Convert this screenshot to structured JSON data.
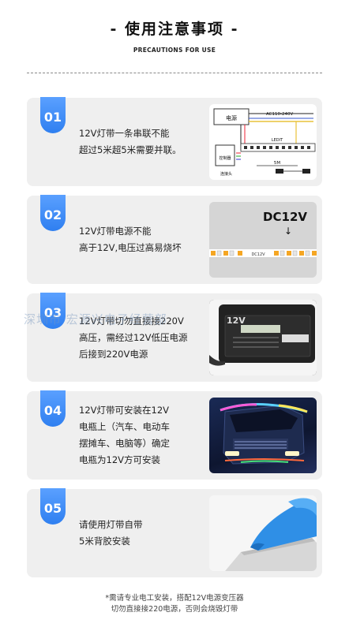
{
  "header": {
    "title": "- 使用注意事项 -",
    "subtitle": "PRECAUTIONS FOR USE"
  },
  "cards": [
    {
      "number": "01",
      "lines": [
        "12V灯带一条串联不能",
        "超过5米超5米需要并联。"
      ],
      "diagram": {
        "power": "电源",
        "voltage": "AC110-240V",
        "controller": "控制器",
        "strip": "LEDIT",
        "length": "5M",
        "plug": "连接头"
      }
    },
    {
      "number": "02",
      "lines": [
        "12V灯带电源不能",
        "高于12V,电压过高易烧坏"
      ],
      "image": {
        "label": "DC12V",
        "strip_label": "DC12V"
      }
    },
    {
      "number": "03",
      "lines": [
        "12V灯带切勿直接接220V",
        "高压，需经过12V低压电源",
        "后接到220V电源"
      ],
      "image": {
        "label": "12V"
      }
    },
    {
      "number": "04",
      "lines": [
        "12V灯带可安装在12V",
        "电瓶上（汽车、电动车",
        "摆摊车、电脑等）确定",
        "电瓶为12V方可安装"
      ]
    },
    {
      "number": "05",
      "lines": [
        "请使用灯带自带",
        "5米背胶安装"
      ]
    }
  ],
  "watermark": "深圳市                    宏源兴电子经营部",
  "footer": {
    "line1": "*需请专业电工安装，搭配12V电源变压器",
    "line2": "切勿直接接220电源，否则会烧毁灯带"
  },
  "colors": {
    "badge": "#3b8cf5",
    "card_bg": "#efefef"
  }
}
